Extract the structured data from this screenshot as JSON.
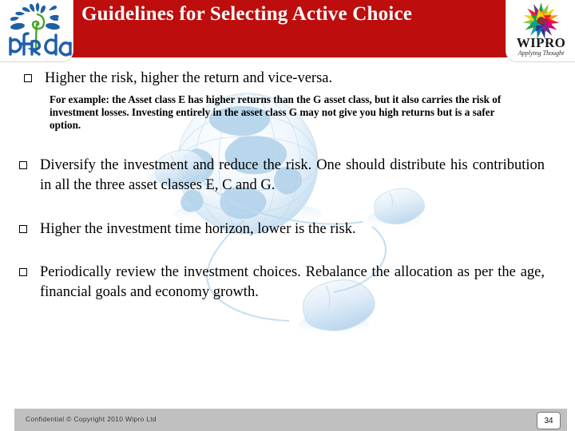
{
  "slide": {
    "title": "Guidelines for Selecting Active Choice",
    "accent_color": "#BE0D0D",
    "footer_bar_color": "#C0C0C0",
    "background": "white with faint light-blue globe and computer-mice watermark"
  },
  "logos": {
    "left": {
      "name": "pFRda",
      "alt": "PFRDA logo",
      "wordmark": "pFRda",
      "color": "#1F5FA9",
      "stem_color": "#4CA32B"
    },
    "right": {
      "name": "WIPRO",
      "alt": "Wipro logo",
      "wordmark": "WIPRO",
      "tagline": "Applying Thought",
      "petal_colors": [
        "#1E9E45",
        "#8DC63F",
        "#F5D000",
        "#F7941E",
        "#ED1C24",
        "#D6006E",
        "#7B2D8E",
        "#2E3192",
        "#0072BC",
        "#00A79D"
      ]
    }
  },
  "bullets": [
    {
      "glyph": "hollow-square",
      "text": "Higher the risk, higher the return and vice-versa.",
      "subtext": "For example: the Asset class E has higher returns than the G asset class, but it also carries the risk of investment losses. Investing entirely in the asset class G may not give you high returns but is a safer option."
    },
    {
      "glyph": "hollow-square",
      "text": "Diversify the investment and reduce the risk. One should distribute his contribution in all the three asset classes E, C and G."
    },
    {
      "glyph": "hollow-square",
      "text": "Higher the investment time horizon, lower is the risk."
    },
    {
      "glyph": "hollow-square",
      "text": "Periodically review the investment choices. Rebalance the allocation as per the age, financial goals and economy growth."
    }
  ],
  "footer": {
    "copyright": "Confidential © Copyright 2010 Wipro Ltd",
    "page_number": "34"
  }
}
